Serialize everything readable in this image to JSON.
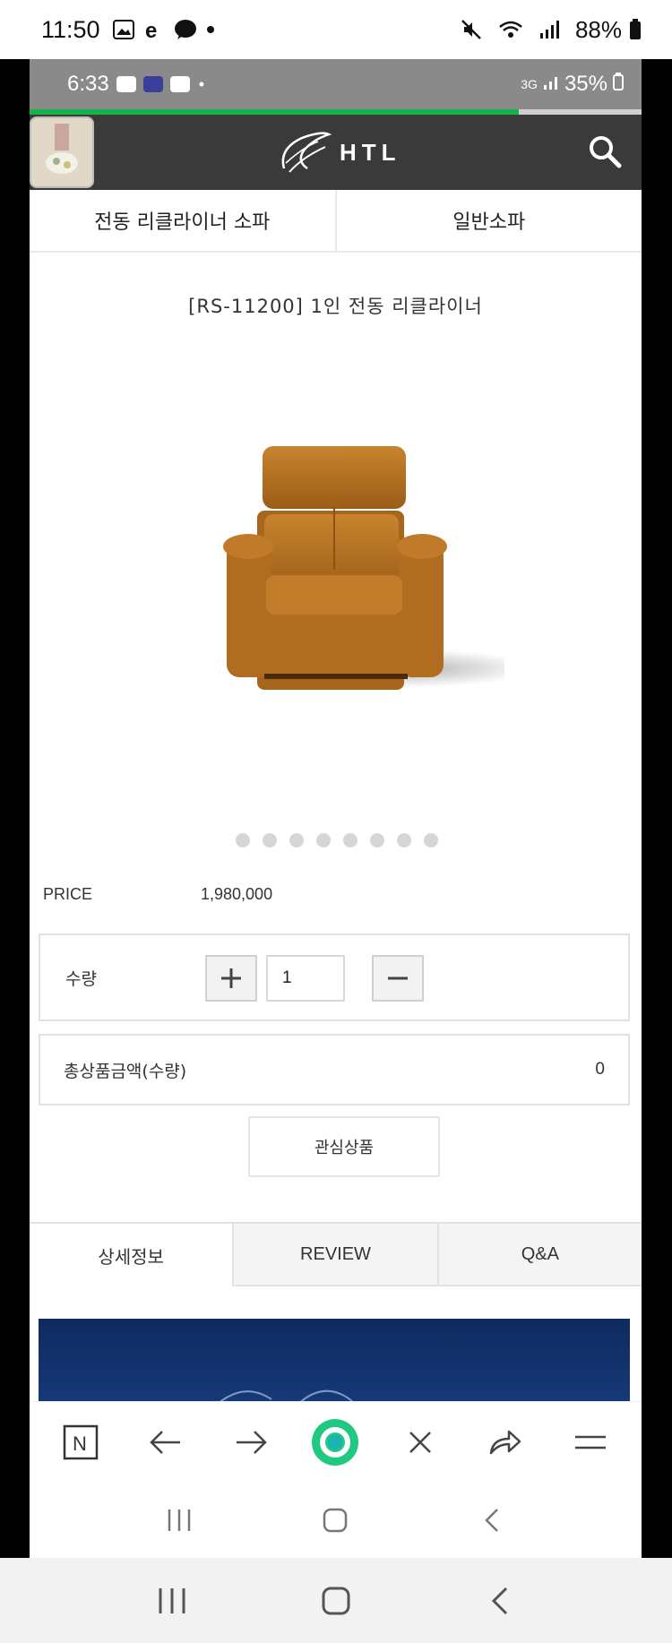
{
  "outer_status": {
    "time": "11:50",
    "battery": "88%",
    "icons": [
      "gallery-icon",
      "edge-e-icon",
      "kakaotalk-icon",
      "dot-icon",
      "mute-icon",
      "wifi-icon",
      "signal-icon",
      "battery-icon"
    ]
  },
  "inner_status": {
    "time": "6:33",
    "network": "3G",
    "battery": "35%",
    "page_load_progress": 0.8
  },
  "site": {
    "logo_text": "HTL"
  },
  "category_tabs": [
    {
      "label": "전동 리클라이너 소파"
    },
    {
      "label": "일반소파"
    }
  ],
  "product": {
    "title": "[RS-11200] 1인 전동 리클라이너",
    "image_alt": "orange leather recliner chair",
    "gallery_dots": 8,
    "price_label": "PRICE",
    "price_value": "1,980,000",
    "qty_label": "수량",
    "qty_value": "1",
    "total_label": "총상품금액(수량)",
    "total_value": "0",
    "wishlist_label": "관심상품"
  },
  "detail_tabs": [
    {
      "label": "상세정보",
      "active": true
    },
    {
      "label": "REVIEW",
      "active": false
    },
    {
      "label": "Q&A",
      "active": false
    }
  ],
  "browser_bar": {
    "n_label": "N",
    "buttons": [
      "naver-n-icon",
      "back-arrow-icon",
      "forward-arrow-icon",
      "green-circle-home-icon",
      "close-x-icon",
      "share-icon",
      "menu-icon"
    ]
  },
  "colors": {
    "header_bg": "#3a3a3a",
    "progress": "#18b24a",
    "banner": "#0f2a60",
    "green_button": "#20c980"
  }
}
